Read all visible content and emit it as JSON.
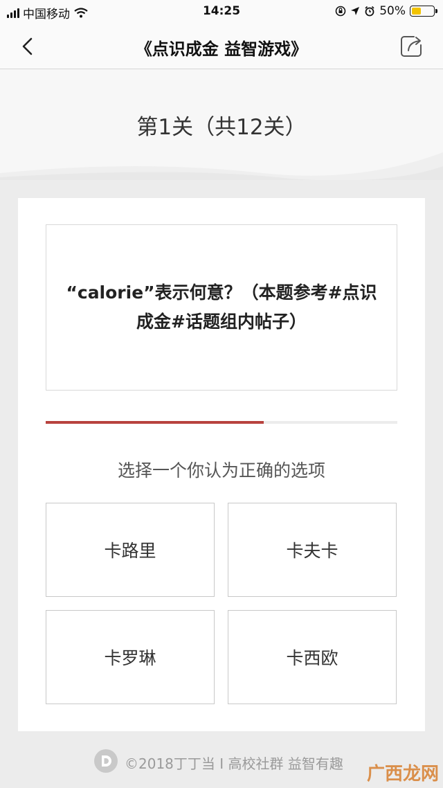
{
  "status_bar": {
    "carrier": "中国移动",
    "time": "14:25",
    "battery_text": "50%",
    "battery_level": 0.5
  },
  "nav": {
    "title": "《点识成金 益智游戏》"
  },
  "level": {
    "title": "第1关（共12关）"
  },
  "quiz": {
    "question": "“calorie”表示何意？（本题参考#点识成金#话题组内帖子）",
    "progress": 0.62,
    "instruction": "选择一个你认为正确的选项",
    "options": [
      "卡路里",
      "卡夫卡",
      "卡罗琳",
      "卡西欧"
    ]
  },
  "footer": {
    "text": "©2018丁丁当 I 高校社群 益智有趣"
  },
  "watermark": {
    "text": "广西龙网"
  },
  "colors": {
    "accent": "#b8423e",
    "battery": "#f2c300"
  }
}
